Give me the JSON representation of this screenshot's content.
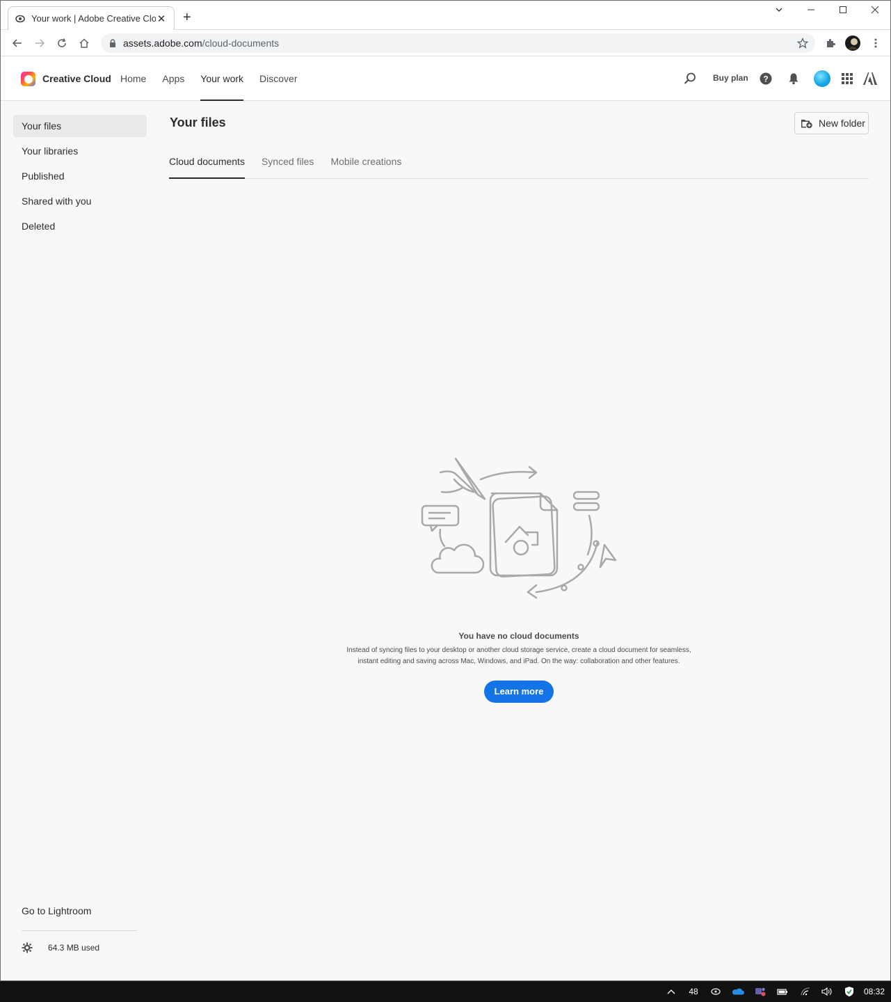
{
  "browser": {
    "tab_title": "Your work | Adobe Creative Cloud",
    "new_tab_symbol": "+",
    "close_tab_symbol": "✕",
    "url_host": "assets.adobe.com",
    "url_path": "/cloud-documents",
    "window_controls": [
      "chevron-down",
      "minimize",
      "maximize",
      "close"
    ]
  },
  "header": {
    "brand": "Creative Cloud",
    "nav": [
      {
        "label": "Home",
        "active": false
      },
      {
        "label": "Apps",
        "active": false
      },
      {
        "label": "Your work",
        "active": true
      },
      {
        "label": "Discover",
        "active": false
      }
    ],
    "buy_plan": "Buy plan",
    "icons": [
      "search-icon",
      "help-icon",
      "bell-icon",
      "avatar",
      "app-grid-icon",
      "adobe-logo-icon"
    ]
  },
  "sidebar": {
    "items": [
      {
        "label": "Your files",
        "active": true
      },
      {
        "label": "Your libraries",
        "active": false
      },
      {
        "label": "Published",
        "active": false
      },
      {
        "label": "Shared with you",
        "active": false
      },
      {
        "label": "Deleted",
        "active": false
      }
    ],
    "lightroom_link": "Go to Lightroom",
    "storage_used": "64.3 MB used"
  },
  "main": {
    "title": "Your files",
    "new_folder_label": "New folder",
    "tabs": [
      {
        "label": "Cloud documents",
        "active": true
      },
      {
        "label": "Synced files",
        "active": false
      },
      {
        "label": "Mobile creations",
        "active": false
      }
    ],
    "empty_title": "You have no cloud documents",
    "empty_desc_line1": "Instead of syncing files to your desktop or another cloud storage service, create a cloud document for seamless,",
    "empty_desc_line2": "instant editing and saving across Mac, Windows, and iPad. On the way: collaboration and other features.",
    "learn_more": "Learn more"
  },
  "taskbar": {
    "tray_number": "48",
    "time": "08:32"
  },
  "colors": {
    "accent": "#1473e6",
    "page_bg": "#f8f8f8",
    "taskbar_bg": "#121212"
  }
}
